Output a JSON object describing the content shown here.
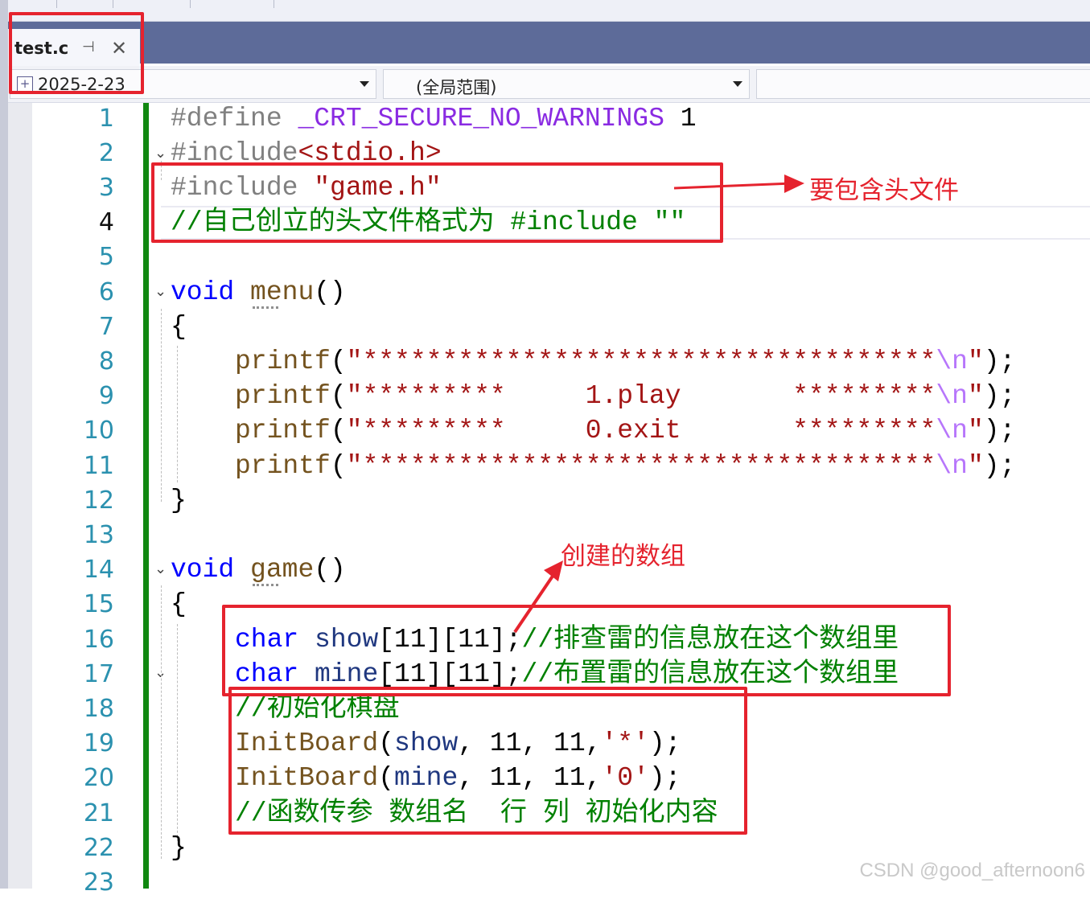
{
  "tab": {
    "title": "test.c",
    "pin": "⊣",
    "close": "✕"
  },
  "navbar": {
    "file_combo": "2025-2-23",
    "scope_combo": "(全局范围)",
    "member_combo": ""
  },
  "lines": [
    {
      "no": "1"
    },
    {
      "no": "2"
    },
    {
      "no": "3"
    },
    {
      "no": "4"
    },
    {
      "no": "5"
    },
    {
      "no": "6"
    },
    {
      "no": "7"
    },
    {
      "no": "8"
    },
    {
      "no": "9"
    },
    {
      "no": "10"
    },
    {
      "no": "11"
    },
    {
      "no": "12"
    },
    {
      "no": "13"
    },
    {
      "no": "14"
    },
    {
      "no": "15"
    },
    {
      "no": "16"
    },
    {
      "no": "17"
    },
    {
      "no": "18"
    },
    {
      "no": "19"
    },
    {
      "no": "20"
    },
    {
      "no": "21"
    },
    {
      "no": "22"
    },
    {
      "no": "23"
    }
  ],
  "code": {
    "l1": {
      "a": "#define ",
      "b": "_CRT_SECURE_NO_WARNINGS",
      "c": " 1"
    },
    "l2": {
      "a": "#include",
      "b": "<stdio.h>"
    },
    "l3": {
      "a": "#include ",
      "b": "\"game.h\""
    },
    "l4": "//自己创立的头文件格式为 #include \"\"",
    "l6": {
      "a": "void",
      "b": " ",
      "c": "menu",
      "d": "()"
    },
    "l7": "{",
    "l8": {
      "a": "printf",
      "b": "(",
      "c": "\"************************************",
      "d": "\\n",
      "e": "\"",
      "f": ");"
    },
    "l9": {
      "a": "printf",
      "b": "(",
      "c": "\"*********     1.play       *********",
      "d": "\\n",
      "e": "\"",
      "f": ");"
    },
    "l10": {
      "a": "printf",
      "b": "(",
      "c": "\"*********     0.exit       *********",
      "d": "\\n",
      "e": "\"",
      "f": ");"
    },
    "l11": {
      "a": "printf",
      "b": "(",
      "c": "\"************************************",
      "d": "\\n",
      "e": "\"",
      "f": ");"
    },
    "l12": "}",
    "l14": {
      "a": "void",
      "b": " ",
      "c": "game",
      "d": "()"
    },
    "l15": "{",
    "l16": {
      "a": "char",
      "b": " ",
      "c": "show",
      "d": "[11][11];",
      "e": "//排查雷的信息放在这个数组里"
    },
    "l17": {
      "a": "char",
      "b": " ",
      "c": "mine",
      "d": "[11][11];",
      "e": "//布置雷的信息放在这个数组里"
    },
    "l18": "//初始化棋盘",
    "l19": {
      "a": "InitBoard",
      "b": "(",
      "c": "show",
      "d": ", 11, 11,",
      "e": "'*'",
      "f": ");"
    },
    "l20": {
      "a": "InitBoard",
      "b": "(",
      "c": "mine",
      "d": ", 11, 11,",
      "e": "'0'",
      "f": ");"
    },
    "l21": "//函数传参 数组名  行 列 初始化内容",
    "l22": "}"
  },
  "annotations": {
    "header_note": "要包含头文件",
    "array_note": "创建的数组"
  },
  "watermark": "CSDN @good_afternoon6",
  "colors": {
    "annotation_red": "#e5232e",
    "comment_green": "#008000",
    "keyword_blue": "#0000ff",
    "string_red": "#a31515",
    "tab_bar": "#5d6b99"
  }
}
